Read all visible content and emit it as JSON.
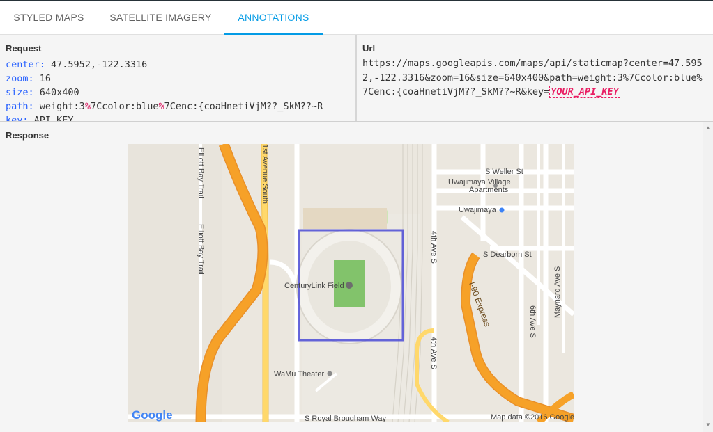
{
  "tabs": [
    {
      "label": "STYLED MAPS"
    },
    {
      "label": "SATELLITE IMAGERY"
    },
    {
      "label": "ANNOTATIONS"
    }
  ],
  "active_tab": "ANNOTATIONS",
  "request": {
    "title": "Request",
    "params": [
      {
        "key": "center:",
        "value": "47.5952,-122.3316"
      },
      {
        "key": "zoom:",
        "value": "16"
      },
      {
        "key": "size:",
        "value": "640x400"
      },
      {
        "key": "path:",
        "value_a": "weight:3",
        "pct_a": "%",
        "value_b": "7Ccolor:blue",
        "pct_b": "%",
        "value_c": "7Cenc:{coaHnetiVjM??_SkM??~R"
      },
      {
        "key": "key:",
        "value": "API_KEY"
      }
    ]
  },
  "url": {
    "title": "Url",
    "text": "https://maps.googleapis.com/maps/api/staticmap?center=47.5952,-122.3316&zoom=16&size=640x400&path=weight:3%7Ccolor:blue%7Cenc:{coaHnetiVjM??_SkM??~R&key=",
    "api_key": "YOUR_API_KEY"
  },
  "response": {
    "title": "Response",
    "map": {
      "labels": {
        "elliott1": "Elliott Bay Trail",
        "elliott2": "Elliott Bay Trail",
        "first_ave": "1st Avenue South",
        "weller": "S Weller St",
        "uwaji_village_1": "Uwajimaya Village",
        "uwaji_village_2": "Apartments",
        "uwajimaya": "Uwajimaya",
        "dearborn": "S Dearborn St",
        "fourth_ave_1": "4th Ave S",
        "fourth_ave_2": "4th Ave S",
        "maynard": "Maynard Ave S",
        "sixth_ave": "6th Ave S",
        "i90": "I-90 Express",
        "centurylink": "CenturyLink Field",
        "wamu": "WaMu Theater",
        "royal_brougham": "S Royal Brougham Way",
        "google": "Google",
        "attribution": "Map data ©2016 Google"
      },
      "colors": {
        "base": "#ebe7df",
        "road": "#ffffff",
        "freeway": "#f6a128",
        "freeway_edge": "#e8902a",
        "arterial": "#ffd86b",
        "park": "#cfe5b7",
        "field": "#82c36b",
        "path_stroke": "#4b4bd6"
      }
    }
  }
}
